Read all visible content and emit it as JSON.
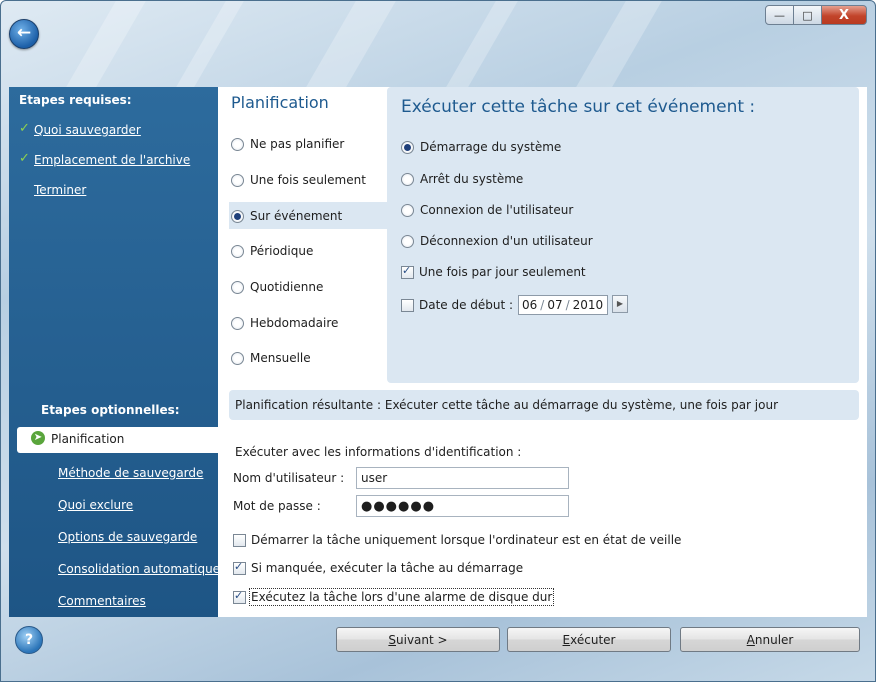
{
  "window": {
    "min_glyph": "—",
    "max_glyph": "□",
    "close_glyph": "X"
  },
  "sidebar": {
    "required_heading": "Etapes requises:",
    "required_items": [
      "Quoi sauvegarder",
      "Emplacement de l'archive",
      "Terminer"
    ],
    "optional_heading": "Etapes optionnelles:",
    "optional_selected": "Planification",
    "optional_items": [
      "Méthode de sauvegarde",
      "Quoi exclure",
      "Options de sauvegarde",
      "Consolidation automatique",
      "Commentaires"
    ]
  },
  "schedule": {
    "title": "Planification",
    "options": [
      "Ne pas planifier",
      "Une fois seulement",
      "Sur événement",
      "Périodique",
      "Quotidienne",
      "Hebdomadaire",
      "Mensuelle"
    ],
    "selected": "Sur événement"
  },
  "event_panel": {
    "title": "Exécuter cette tâche sur cet événement :",
    "events": [
      "Démarrage du système",
      "Arrêt du système",
      "Connexion de l'utilisateur",
      "Déconnexion d'un utilisateur"
    ],
    "selected": "Démarrage du système",
    "once_per_day_label": "Une fois par jour seulement",
    "once_per_day_checked": true,
    "start_date_label": "Date de début :",
    "start_date_checked": false,
    "date_day": "06",
    "date_month": "07",
    "date_year": "2010"
  },
  "result": {
    "label": "Planification résultante :",
    "text": "Exécuter cette tâche au démarrage du système, une fois par jour"
  },
  "credentials": {
    "heading": "Exécuter avec les informations d'identification :",
    "user_label": "Nom d'utilisateur :",
    "user_value": "user",
    "password_label": "Mot de passe :",
    "password_value": "●●●●●●"
  },
  "options": {
    "idle_label": "Démarrer la tâche uniquement lorsque l'ordinateur est en état de veille",
    "idle_checked": false,
    "missed_label": "Si manquée, exécuter la tâche au démarrage",
    "missed_checked": true,
    "disk_alarm_label": "Exécutez la tâche lors d'une alarme de disque dur",
    "disk_alarm_checked": true
  },
  "footer": {
    "help_glyph": "?",
    "next_key": "S",
    "next_rest": "uivant >",
    "run_key": "E",
    "run_rest": "xécuter",
    "cancel_key": "A",
    "cancel_rest": "nnuler"
  }
}
